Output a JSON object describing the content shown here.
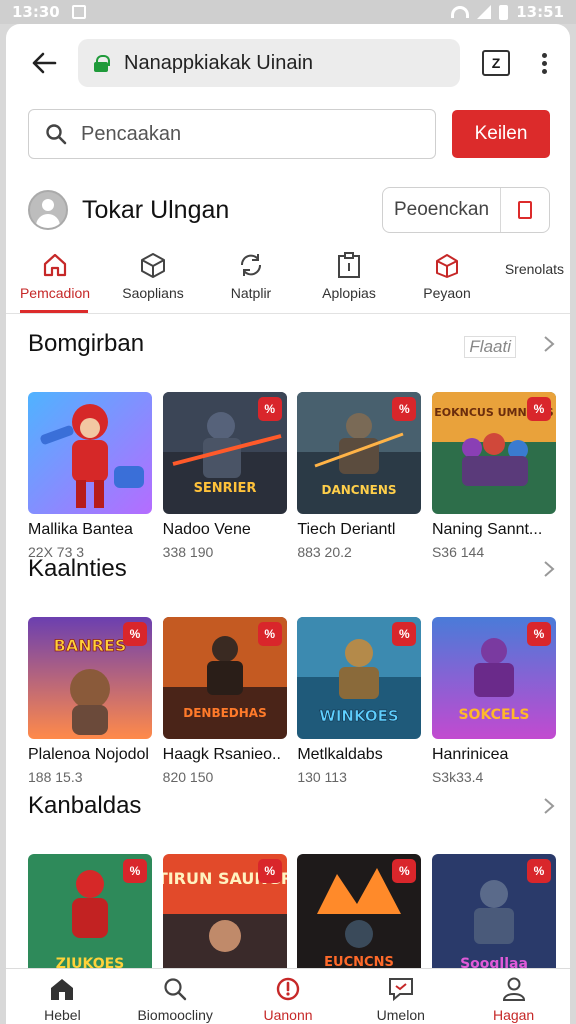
{
  "status_bar": {
    "time_left": "13:30",
    "time_right": "13:51"
  },
  "browser": {
    "url": "Nanappkiakak Uinain",
    "tab_count": "Z"
  },
  "search": {
    "placeholder": "Pencaakan",
    "button_label": "Keilen"
  },
  "store": {
    "name": "Tokar Ulngan",
    "action_label": "Peoenckan"
  },
  "categories": [
    {
      "label": "Pemcadion",
      "icon": "home-icon",
      "active": true
    },
    {
      "label": "Saoplians",
      "icon": "box-icon"
    },
    {
      "label": "Natplir",
      "icon": "recycle-icon"
    },
    {
      "label": "Aplopias",
      "icon": "clipboard-icon"
    },
    {
      "label": "Peyaon",
      "icon": "gift-icon"
    }
  ],
  "categories_more": "Srenolats",
  "sections": [
    {
      "title": "Bomgirban",
      "see_all": "Flaati",
      "items": [
        {
          "title": "Mallika Bantea",
          "meta": "22X 73 3"
        },
        {
          "title": "Nadoo Vene",
          "meta": "338 190",
          "badge": "%"
        },
        {
          "title": "Tiech Deriantl",
          "meta": "883 20.2",
          "badge": "%"
        },
        {
          "title": "Naning Sannt...",
          "meta": "S36 144",
          "badge": "%"
        }
      ]
    },
    {
      "title": "Kaalnties",
      "items": [
        {
          "title": "Plalenoa Nojodol",
          "meta": "188 15.3",
          "badge": "%"
        },
        {
          "title": "Haagk Rsanieo..",
          "meta": "820 150",
          "badge": "%"
        },
        {
          "title": "Metlkaldabs",
          "meta": "130 113",
          "badge": "%"
        },
        {
          "title": "Hanrinicea",
          "meta": "S3k33.4",
          "badge": "%"
        }
      ]
    },
    {
      "title": "Kanbaldas",
      "items": [
        {
          "title": "",
          "meta": "",
          "badge": "%"
        },
        {
          "title": "",
          "meta": "",
          "badge": "%"
        },
        {
          "title": "",
          "meta": "",
          "badge": "%"
        },
        {
          "title": "",
          "meta": "",
          "badge": "%"
        }
      ]
    }
  ],
  "thumb_text": [
    "",
    "SENRIER",
    "DANCNENS",
    "EOKNCUS UMNIEES",
    "BANRES",
    "DENBEDHAS",
    "WINKOES",
    "SOKCELS",
    "ZIUKOES",
    "TIRUN SAUNGR",
    "EUCNCNS",
    "Soogllaa"
  ],
  "bottom_nav": [
    {
      "label": "Hebel",
      "icon": "home-icon"
    },
    {
      "label": "Biomoocliny",
      "icon": "search-icon"
    },
    {
      "label": "Uanonn",
      "icon": "alert-icon"
    },
    {
      "label": "Umelon",
      "icon": "message-icon"
    },
    {
      "label": "Hagan",
      "icon": "user-icon"
    }
  ],
  "colors": {
    "accent": "#dc2b2b",
    "link_green": "#1f9a3a"
  }
}
